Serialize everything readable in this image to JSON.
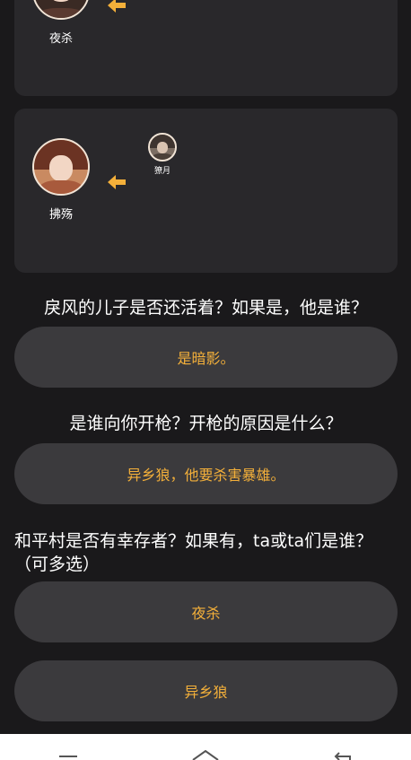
{
  "cards": [
    {
      "main_name": "夜杀"
    },
    {
      "main_name": "拂殇",
      "small_name": "獠月"
    }
  ],
  "questions": [
    {
      "text": "戾风的儿子是否还活着？如果是，他是谁？",
      "options": [
        "是暗影。"
      ]
    },
    {
      "text": "是谁向你开枪？开枪的原因是什么？",
      "options": [
        "异乡狼，他要杀害暴雄。"
      ]
    },
    {
      "text": "和平村是否有幸存者？如果有，ta或ta们是谁？（可多选）",
      "options": [
        "夜杀",
        "异乡狼"
      ]
    }
  ],
  "icons": {
    "arrow": "left-arrow-icon",
    "nav": [
      "menu-icon",
      "home-icon",
      "back-icon"
    ]
  },
  "colors": {
    "background": "#1a191b",
    "card": "#29282b",
    "option": "#3b3a3d",
    "accent": "#f4b03a"
  }
}
